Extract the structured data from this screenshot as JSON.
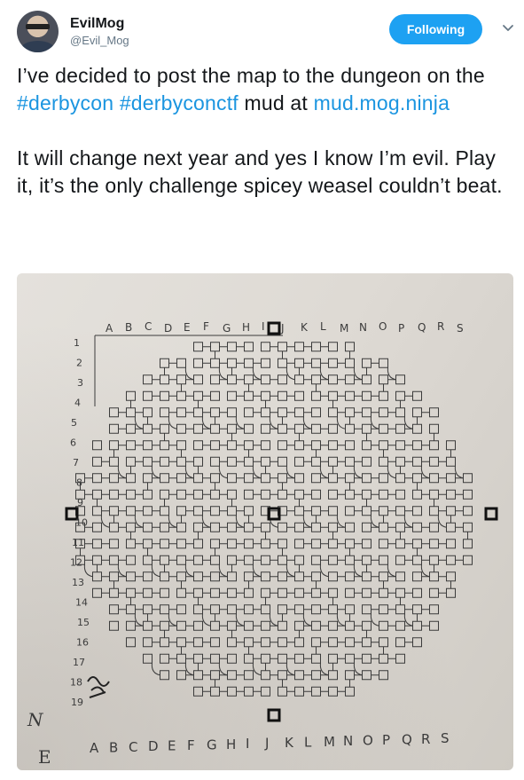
{
  "author": {
    "display_name": "EvilMog",
    "handle": "@Evil_Mog",
    "avatar_icon": "profile-photo"
  },
  "follow_button": {
    "label": "Following",
    "color": "#1da1f2"
  },
  "menu": {
    "icon": "chevron-down-icon"
  },
  "tweet": {
    "p1_a": "I’ve decided to post the map to the dungeon on the ",
    "hashtag1": "#derbycon",
    "p1_b": " ",
    "hashtag2": "#derbyconctf",
    "p1_c": " mud at ",
    "link": "mud.mog.ninja",
    "p2": "It will change next year and yes I know I’m evil.  Play it, it’s the only challenge spicey weasel couldn’t beat."
  },
  "media": {
    "description_icon": "hand-drawn-dungeon-map",
    "top_letters": [
      "A",
      "B",
      "C",
      "D",
      "E",
      "F",
      "G",
      "H",
      "I",
      "J",
      "K",
      "L",
      "M",
      "N",
      "O",
      "P",
      "Q",
      "R",
      "S"
    ],
    "bottom_letters": [
      "A",
      "B",
      "C",
      "D",
      "E",
      "F",
      "G",
      "H",
      "I",
      "J",
      "K",
      "L",
      "M",
      "N",
      "O",
      "P",
      "Q",
      "R",
      "S"
    ],
    "row_numbers": [
      "1",
      "2",
      "3",
      "4",
      "5",
      "6",
      "7",
      "8",
      "9",
      "10",
      "11",
      "12",
      "13",
      "14",
      "15",
      "16",
      "17",
      "18",
      "19"
    ],
    "compass": [
      "N",
      "E"
    ],
    "ink_color": "#3b3b3b"
  }
}
